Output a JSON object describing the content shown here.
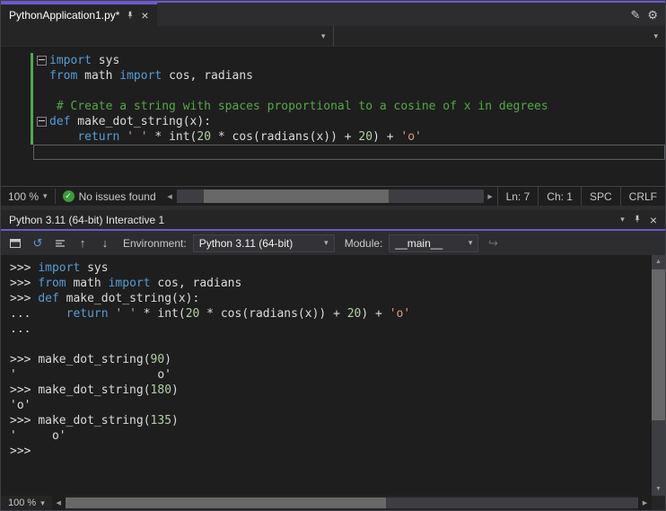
{
  "accent_color": "#6a5acd",
  "glyphs": {
    "chevron_down": "▾",
    "close": "×",
    "gear": "⚙",
    "pencil": "✎",
    "reset": "↺",
    "arrow_up": "↑",
    "arrow_down": "↓",
    "redo": "↪",
    "check": "✓",
    "left": "◀",
    "right": "▶",
    "scroll_up": "▲",
    "scroll_down": "▼"
  },
  "editor": {
    "tab_title": "PythonApplication1.py*",
    "lines": [
      {
        "green": true,
        "fold": true,
        "tokens": [
          [
            "k",
            "import"
          ],
          [
            "d",
            " sys"
          ]
        ]
      },
      {
        "green": true,
        "fold": false,
        "tokens": [
          [
            "k",
            "from"
          ],
          [
            "d",
            " math "
          ],
          [
            "k",
            "import"
          ],
          [
            "d",
            " cos, radians"
          ]
        ]
      },
      {
        "green": true,
        "fold": false,
        "tokens": []
      },
      {
        "green": true,
        "fold": false,
        "tokens": [
          [
            "c",
            " # Create a string with spaces proportional to a cosine of x in degrees"
          ]
        ]
      },
      {
        "green": true,
        "fold": true,
        "tokens": [
          [
            "k",
            "def"
          ],
          [
            "d",
            " make_dot_string(x):"
          ]
        ]
      },
      {
        "green": true,
        "fold": false,
        "tokens": [
          [
            "d",
            "    "
          ],
          [
            "k",
            "return"
          ],
          [
            "d",
            " "
          ],
          [
            "s",
            "' '"
          ],
          [
            "d",
            " * int("
          ],
          [
            "n",
            "20"
          ],
          [
            "d",
            " * cos(radians(x)) + "
          ],
          [
            "n",
            "20"
          ],
          [
            "d",
            ") + "
          ],
          [
            "s",
            "'o'"
          ]
        ]
      },
      {
        "green": false,
        "fold": false,
        "caret": true,
        "tokens": []
      }
    ],
    "status": {
      "zoom": "100 %",
      "issues": "No issues found",
      "ln": "Ln: 7",
      "ch": "Ch: 1",
      "spc": "SPC",
      "eol": "CRLF"
    }
  },
  "interactive": {
    "title": "Python 3.11 (64-bit) Interactive 1",
    "toolbar": {
      "environment_label": "Environment:",
      "environment_value": "Python 3.11 (64-bit)",
      "module_label": "Module:",
      "module_value": "__main__"
    },
    "lines": [
      {
        "tokens": [
          [
            "p",
            ">>> "
          ],
          [
            "k",
            "import"
          ],
          [
            "d",
            " sys"
          ]
        ]
      },
      {
        "tokens": [
          [
            "p",
            ">>> "
          ],
          [
            "k",
            "from"
          ],
          [
            "d",
            " math "
          ],
          [
            "k",
            "import"
          ],
          [
            "d",
            " cos, radians"
          ]
        ]
      },
      {
        "tokens": [
          [
            "p",
            ">>> "
          ],
          [
            "k",
            "def"
          ],
          [
            "d",
            " make_dot_string(x):"
          ]
        ]
      },
      {
        "tokens": [
          [
            "p",
            "... "
          ],
          [
            "d",
            "    "
          ],
          [
            "k",
            "return"
          ],
          [
            "d",
            " "
          ],
          [
            "s",
            "' '"
          ],
          [
            "d",
            " * int("
          ],
          [
            "n",
            "20"
          ],
          [
            "d",
            " * cos(radians(x)) + "
          ],
          [
            "n",
            "20"
          ],
          [
            "d",
            ") + "
          ],
          [
            "s",
            "'o'"
          ]
        ]
      },
      {
        "tokens": [
          [
            "p",
            "..."
          ]
        ]
      },
      {
        "tokens": []
      },
      {
        "tokens": [
          [
            "p",
            ">>> "
          ],
          [
            "d",
            "make_dot_string("
          ],
          [
            "n",
            "90"
          ],
          [
            "d",
            ")"
          ]
        ]
      },
      {
        "tokens": [
          [
            "d",
            "'                    o'"
          ]
        ]
      },
      {
        "tokens": [
          [
            "p",
            ">>> "
          ],
          [
            "d",
            "make_dot_string("
          ],
          [
            "n",
            "180"
          ],
          [
            "d",
            ")"
          ]
        ]
      },
      {
        "tokens": [
          [
            "d",
            "'o'"
          ]
        ]
      },
      {
        "tokens": [
          [
            "p",
            ">>> "
          ],
          [
            "d",
            "make_dot_string("
          ],
          [
            "n",
            "135"
          ],
          [
            "d",
            ")"
          ]
        ]
      },
      {
        "tokens": [
          [
            "d",
            "'     o'"
          ]
        ]
      },
      {
        "tokens": [
          [
            "p",
            ">>>"
          ]
        ]
      }
    ],
    "status": {
      "zoom": "100 %"
    }
  }
}
